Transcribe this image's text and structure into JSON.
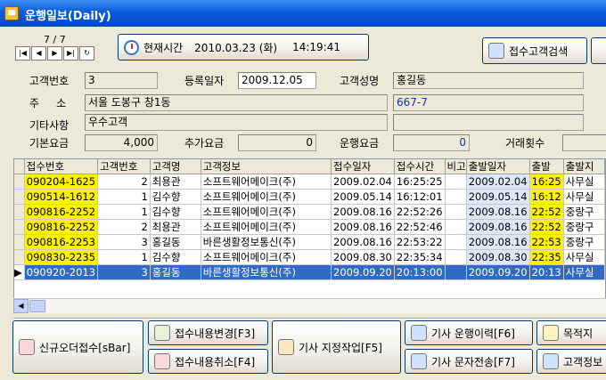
{
  "window": {
    "title": "운행일보(Daily)"
  },
  "pager": {
    "position": "7 / 7"
  },
  "nav": {
    "first": "|◀",
    "prev": "◀",
    "next": "▶",
    "last": "▶|",
    "refresh": "↻"
  },
  "current_time": {
    "label": "현재시간",
    "date": "2010.03.23 (화)",
    "time": "14:19:41"
  },
  "toolbar": {
    "customer_search": "접수고객검색"
  },
  "form": {
    "customer_no_label": "고객번호",
    "customer_no": "3",
    "reg_date_label": "등록일자",
    "reg_date": "2009.12.05",
    "customer_name_label": "고객성명",
    "customer_name": "홍길동",
    "address_label": "주     소",
    "address": "서울 도봉구 창1동",
    "address_detail": "667-7",
    "notes_label": "기타사항",
    "notes": "우수고객",
    "notes_extra": "",
    "base_fee_label": "기본요금",
    "base_fee": "4,000",
    "extra_fee_label": "추가요금",
    "extra_fee": "0",
    "fare_label": "운행요금",
    "fare": "0",
    "trade_count_label": "거래횟수",
    "trade_count": ""
  },
  "table": {
    "columns": [
      "접수번호",
      "고객번호",
      "고객명",
      "고객정보",
      "접수일자",
      "접수시간",
      "비고",
      "출발일자",
      "출발",
      "출발지"
    ],
    "rows": [
      {
        "receipt_no": "090204-1625",
        "customer_no": "2",
        "name": "최용관",
        "info": "소프트웨어메이크(주)",
        "receipt_date": "2009.02.04",
        "receipt_time": "16:25:25",
        "note": "",
        "depart_date": "2009.02.04",
        "depart": "16:25",
        "origin": "사무실",
        "selected": false
      },
      {
        "receipt_no": "090514-1612",
        "customer_no": "1",
        "name": "김수향",
        "info": "소프트웨어메이크(주)",
        "receipt_date": "2009.05.14",
        "receipt_time": "16:12:01",
        "note": "",
        "depart_date": "2009.05.14",
        "depart": "16:12",
        "origin": "사무실",
        "selected": false
      },
      {
        "receipt_no": "090816-2252",
        "customer_no": "1",
        "name": "김수향",
        "info": "소프트웨어메이크(주)",
        "receipt_date": "2009.08.16",
        "receipt_time": "22:52:26",
        "note": "",
        "depart_date": "2009.08.16",
        "depart": "22:52",
        "origin": "중랑구",
        "selected": false
      },
      {
        "receipt_no": "090816-2252",
        "customer_no": "2",
        "name": "최용관",
        "info": "소프트웨어메이크(주)",
        "receipt_date": "2009.08.16",
        "receipt_time": "22:52:46",
        "note": "",
        "depart_date": "2009.08.16",
        "depart": "22:52",
        "origin": "중랑구",
        "selected": false
      },
      {
        "receipt_no": "090816-2253",
        "customer_no": "3",
        "name": "홍길동",
        "info": "바른생활정보통신(주)",
        "receipt_date": "2009.08.16",
        "receipt_time": "22:53:22",
        "note": "",
        "depart_date": "2009.08.16",
        "depart": "22:53",
        "origin": "중랑구",
        "selected": false
      },
      {
        "receipt_no": "090830-2235",
        "customer_no": "1",
        "name": "김수향",
        "info": "소프트웨어메이크(주)",
        "receipt_date": "2009.08.30",
        "receipt_time": "22:35:34",
        "note": "",
        "depart_date": "2009.08.30",
        "depart": "22:35",
        "origin": "사무실",
        "selected": false
      },
      {
        "receipt_no": "090920-2013",
        "customer_no": "3",
        "name": "홍길동",
        "info": "바른생활정보통신(주)",
        "receipt_date": "2009.09.20",
        "receipt_time": "20:13:00",
        "note": "",
        "depart_date": "2009.09.20",
        "depart": "20:13",
        "origin": "사무실",
        "selected": true
      }
    ]
  },
  "scroll": {
    "left": "◀"
  },
  "actions": {
    "new_order": "신규오더접수[sBar]",
    "edit_receipt": "접수내용변경[F3]",
    "cancel_receipt": "접수내용취소[F4]",
    "assign_driver": "기사 지정작업[F5]",
    "driver_history": "기사 운행이력[F6]",
    "driver_sms": "기사 문자전송[F7]",
    "destination": "목적지 ",
    "customer_info": "고객정보"
  },
  "colors": {
    "title_bar": "#0a5bd8",
    "highlight_yellow": "#fff200",
    "selection_blue": "#316ac5",
    "date_blue": "#dde8f6"
  },
  "icons": {
    "app": "app-icon",
    "clock": "clock-icon",
    "search": "search-user-icon"
  }
}
